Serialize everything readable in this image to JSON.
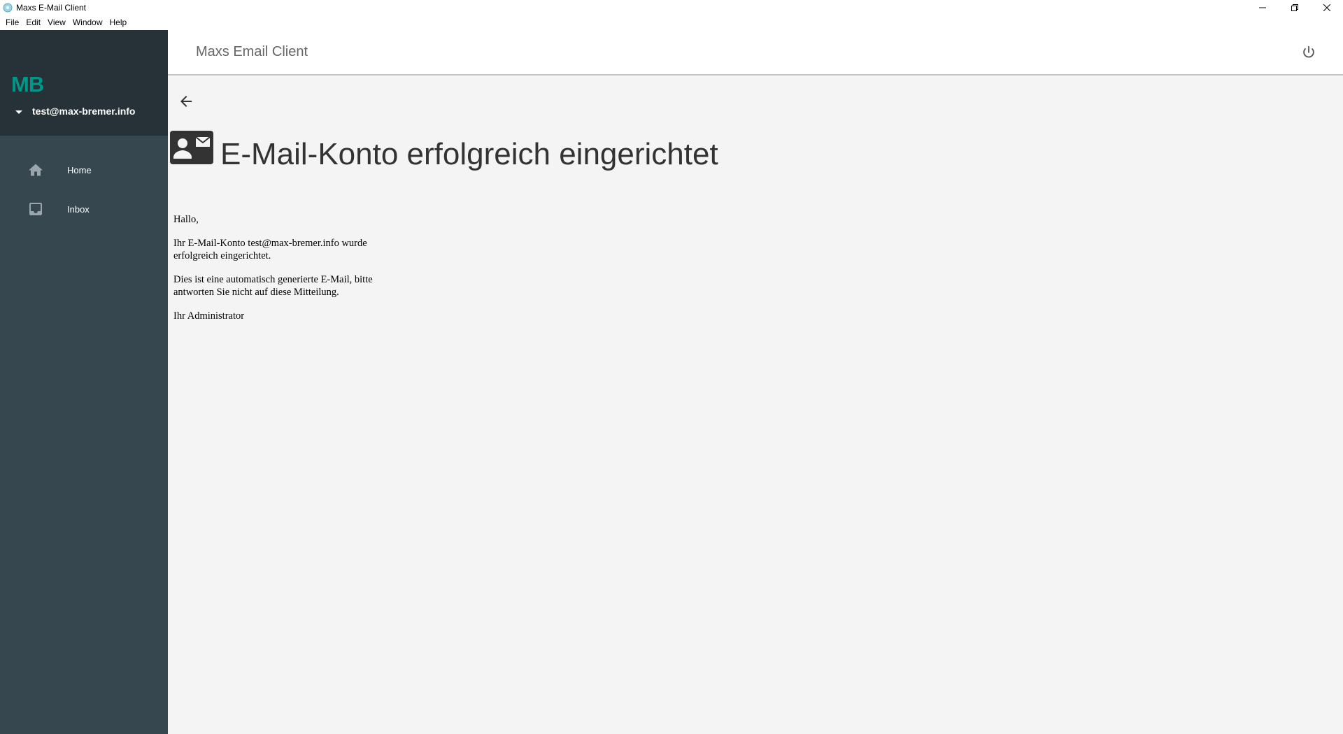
{
  "window": {
    "title": "Maxs E-Mail Client"
  },
  "menu": {
    "items": [
      "File",
      "Edit",
      "View",
      "Window",
      "Help"
    ]
  },
  "sidebar": {
    "logo": "MB",
    "account_email": "test@max-bremer.info",
    "items": [
      {
        "label": "Home",
        "icon": "home-icon"
      },
      {
        "label": "Inbox",
        "icon": "inbox-icon"
      }
    ]
  },
  "topbar": {
    "app_title": "Maxs Email Client"
  },
  "message": {
    "subject": "E-Mail-Konto erfolgreich eingerichtet",
    "body": {
      "greeting": "Hallo,",
      "paragraph1": "Ihr E-Mail-Konto test@max-bremer.info wurde erfolgreich eingerichtet.",
      "paragraph2": "Dies ist eine automatisch generierte E-Mail, bitte antworten Sie nicht auf diese Mitteilung.",
      "signature": "Ihr Administrator"
    }
  },
  "colors": {
    "sidebar_bg": "#37474f",
    "sidebar_header_bg": "#263238",
    "brand_teal": "#009688",
    "content_bg": "#f4f4f4"
  }
}
